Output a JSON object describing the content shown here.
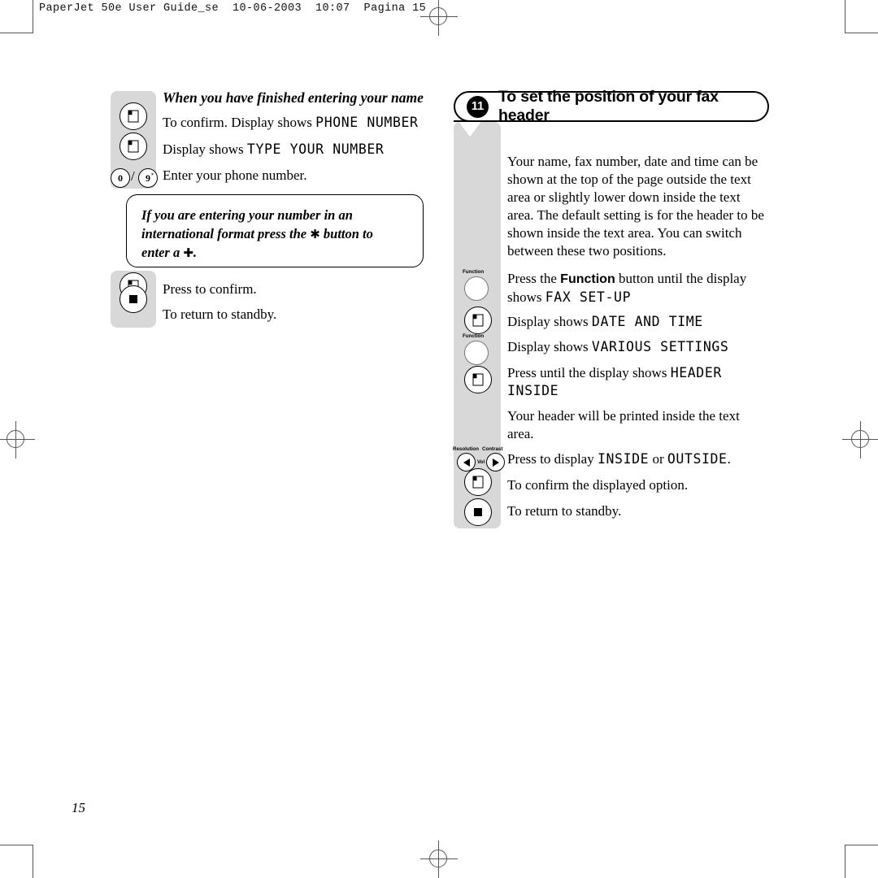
{
  "running_head": "PaperJet 50e User Guide_se  10-06-2003  10:07  Pagina 15",
  "page_number": "15",
  "left_column": {
    "subheading": "When you have finished entering your name",
    "steps": [
      {
        "icon": "start-button-icon",
        "text_before": "To confirm. Display shows ",
        "lcd": "PHONE NUMBER",
        "text_after": ""
      },
      {
        "icon": "start-button-icon",
        "text_before": "Display shows ",
        "lcd": "TYPE YOUR NUMBER",
        "text_after": ""
      },
      {
        "icon": "keypad-0-9-icon",
        "text_before": "Enter your phone number.",
        "lcd": "",
        "text_after": ""
      }
    ],
    "tip": {
      "line1_a": "If you are entering your number in an",
      "line2_a": "international format press the ",
      "line2_symbol": "✱",
      "line2_b": " button to",
      "line3_a": "enter a ",
      "line3_symbol": "✚",
      "line3_b": "."
    },
    "steps_after_tip": [
      {
        "icon": "start-button-icon",
        "text": "Press to confirm."
      },
      {
        "icon": "stop-button-icon",
        "text": "To return to standby."
      }
    ]
  },
  "right_column": {
    "heading": {
      "number": "11",
      "title": "To set the position of your fax header"
    },
    "intro": "Your name, fax number, date and time can be shown at the top of the page outside the text area or slightly lower down inside the text area. The default setting is for the header to be shown inside the text area. You can switch between these two positions.",
    "steps": [
      {
        "icon": "function-button-icon",
        "icon_label": "Function",
        "line1_a": "Press the ",
        "line1_bold": "Function",
        "line1_b": " button until the display",
        "line2_a": "shows ",
        "line2_lcd": "FAX SET-UP"
      },
      {
        "icon": "start-button-icon",
        "icon_label": "",
        "line1_a": "Display shows ",
        "line1_lcd": "DATE AND TIME"
      },
      {
        "icon": "function-button-icon",
        "icon_label": "Function",
        "line1_a": "Display shows ",
        "line1_lcd": "VARIOUS SETTINGS"
      },
      {
        "icon": "start-button-icon",
        "icon_label": "",
        "line1_a": "Press until the display shows ",
        "line1_lcd": "HEADER",
        "line2_lcd": "INSIDE"
      },
      {
        "icon": "",
        "icon_label": "",
        "line1_a": "Your header will be printed inside the text",
        "line2_a": "area."
      },
      {
        "icon": "arrow-buttons-icon",
        "icon_label_left": "Resolution",
        "icon_label_right": "Contrast",
        "icon_label_mid": "Vol",
        "line1_a": "Press to display ",
        "line1_lcd": "INSIDE",
        "line1_b": " or ",
        "line1_lcd2": "OUTSIDE",
        "line1_c": "."
      },
      {
        "icon": "start-button-icon",
        "icon_label": "",
        "line1_a": "To confirm the displayed option."
      },
      {
        "icon": "stop-button-icon",
        "icon_label": "",
        "line1_a": "To return to standby."
      }
    ]
  }
}
